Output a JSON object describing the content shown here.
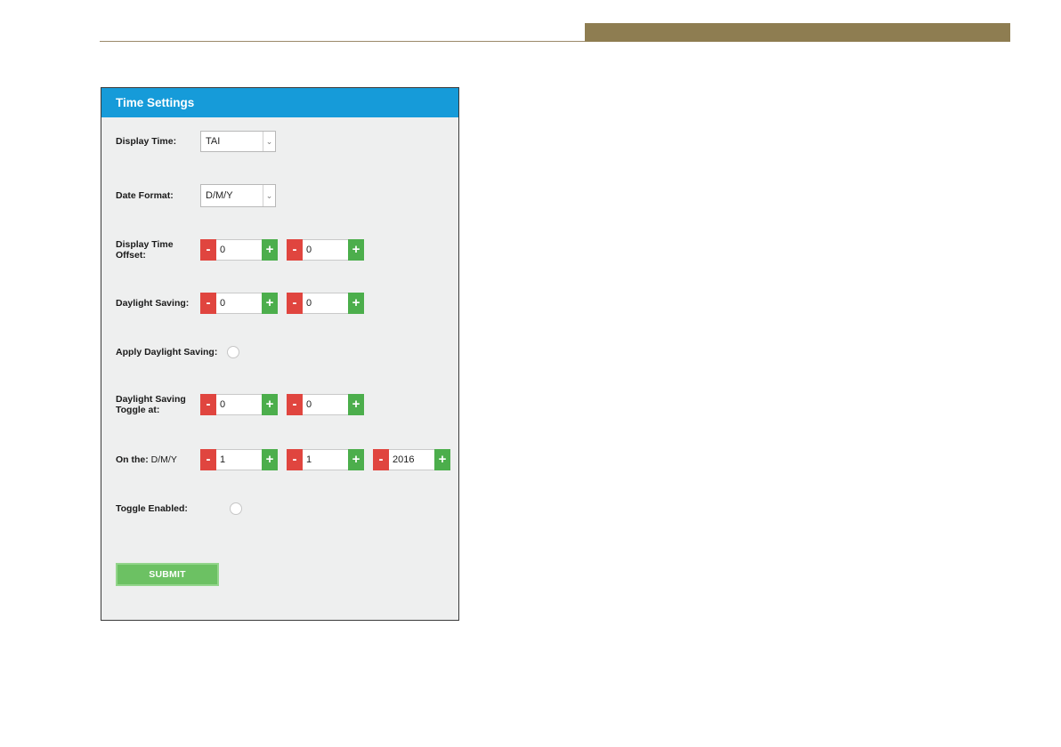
{
  "panel": {
    "title": "Time Settings"
  },
  "display_time": {
    "label": "Display Time:",
    "value": "TAI"
  },
  "date_format": {
    "label": "Date Format:",
    "value": "D/M/Y"
  },
  "display_time_offset": {
    "label_line1": "Display Time",
    "label_line2": "Offset:",
    "first": "0",
    "second": "0"
  },
  "daylight_saving": {
    "label": "Daylight Saving:",
    "first": "0",
    "second": "0"
  },
  "apply_daylight_saving": {
    "label": "Apply Daylight Saving:"
  },
  "daylight_saving_toggle": {
    "label_line1": "Daylight Saving",
    "label_line2": "Toggle at:",
    "first": "0",
    "second": "0"
  },
  "on_the": {
    "label": "On the:",
    "format": "D/M/Y",
    "day": "1",
    "month": "1",
    "year": "2016"
  },
  "toggle_enabled": {
    "label": "Toggle Enabled:"
  },
  "buttons": {
    "minus_symbol": "-",
    "plus_symbol": "+",
    "chevron": "⌄",
    "submit": "SUBMIT"
  },
  "colors": {
    "header_blue": "#169bd9",
    "minus_red": "#e0453f",
    "plus_green": "#4cae4c",
    "submit_green": "#6cc163",
    "top_bar_gold": "#8e7d51"
  }
}
